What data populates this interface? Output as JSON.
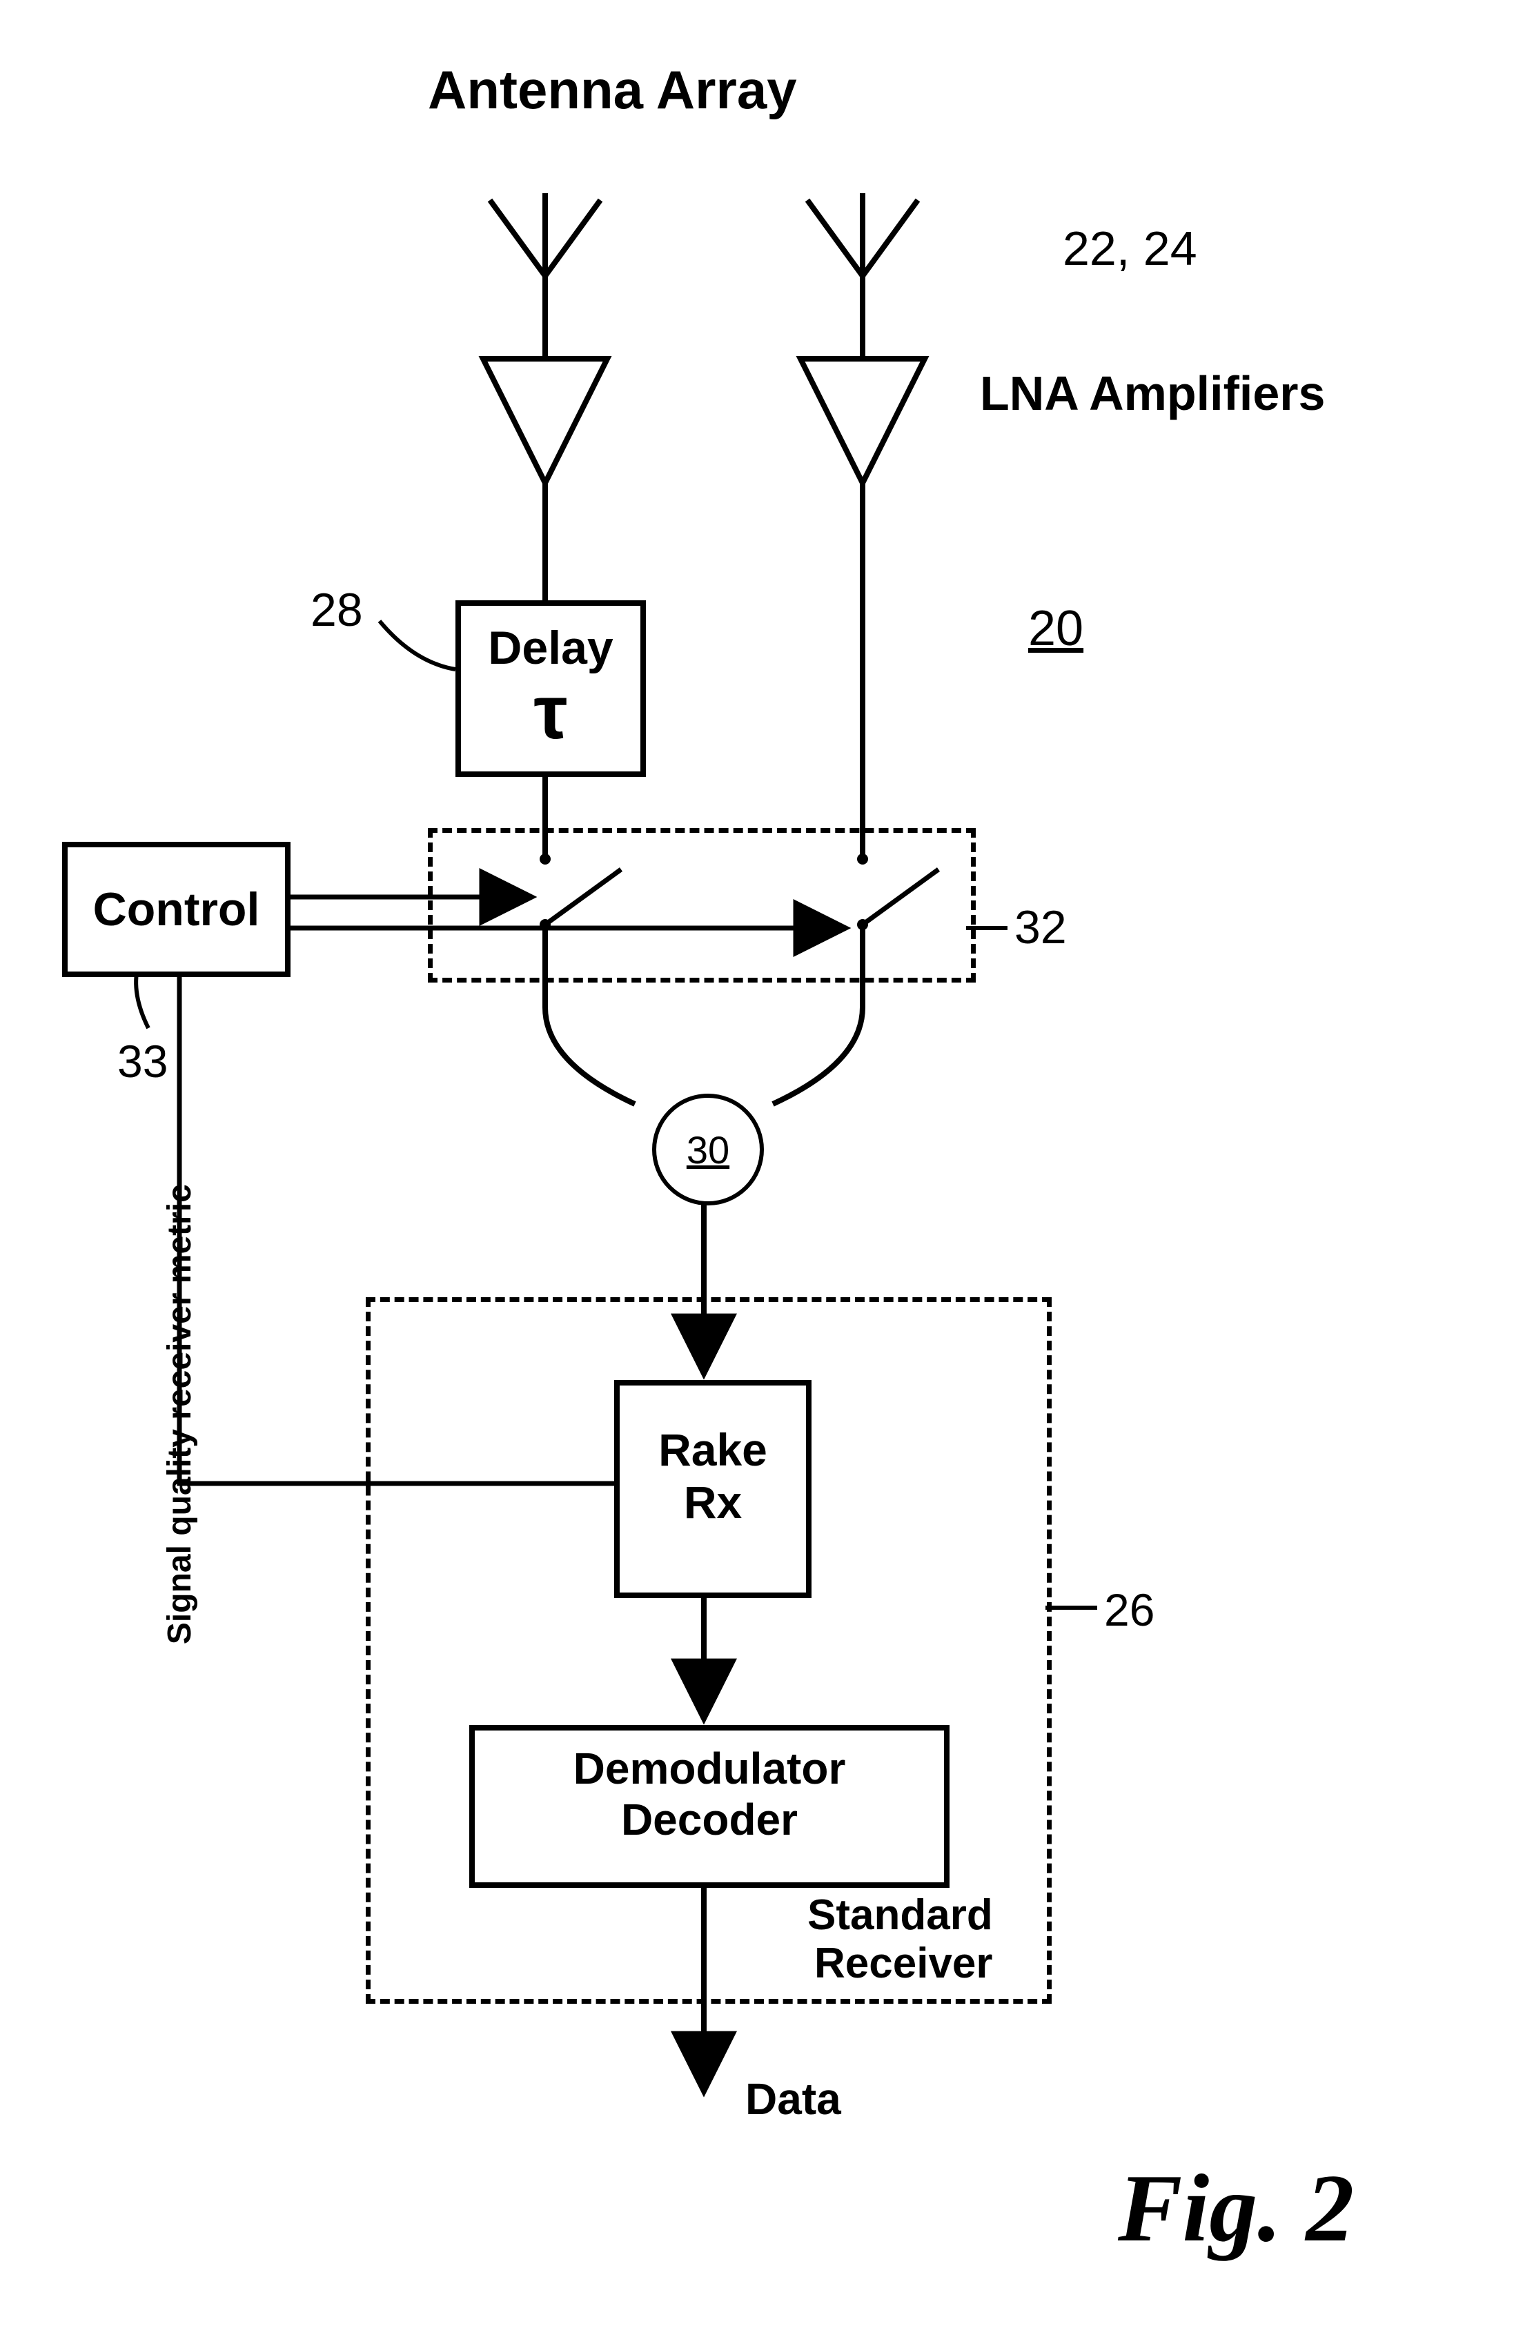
{
  "title": "Antenna Array",
  "lna_label": "LNA Amplifiers",
  "ref_22_24": "22, 24",
  "ref_28": "28",
  "ref_20": "20",
  "ref_32": "32",
  "ref_33": "33",
  "ref_30": "30",
  "ref_26": "26",
  "delay_label": "Delay",
  "tau_symbol": "τ",
  "control_label": "Control",
  "rake_line1": "Rake",
  "rake_line2": "Rx",
  "demod_line1": "Demodulator",
  "demod_line2": "Decoder",
  "standard_line1": "Standard",
  "standard_line2": "Receiver",
  "data_label": "Data",
  "feedback_label": "Signal quality\nreceiver\nmetric",
  "figure_label": "Fig. 2"
}
